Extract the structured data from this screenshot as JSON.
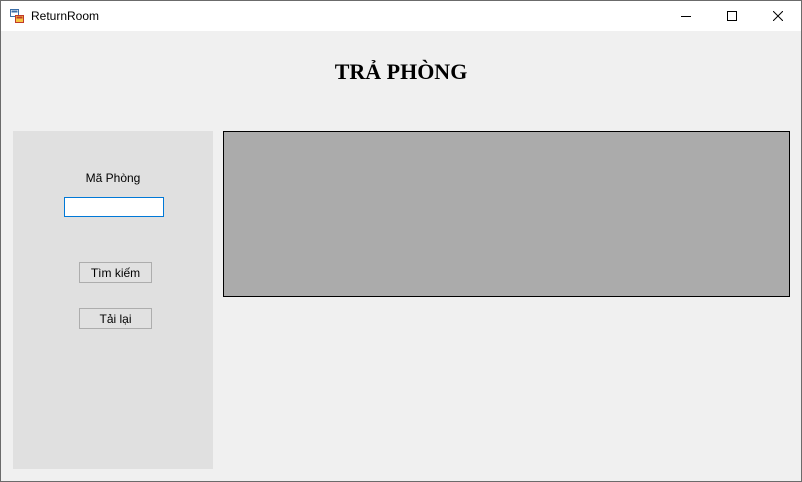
{
  "window": {
    "title": "ReturnRoom",
    "app_icon": "winforms-app-icon",
    "controls": {
      "minimize": "minimize-icon",
      "maximize": "maximize-icon",
      "close": "close-icon"
    }
  },
  "main": {
    "heading": "TRẢ PHÒNG"
  },
  "search_panel": {
    "room_code_label": "Mã Phòng",
    "room_code_value": "",
    "search_button": "Tìm kiếm",
    "reload_button": "Tải lại"
  },
  "results_grid": {
    "background_color": "#ababab"
  }
}
